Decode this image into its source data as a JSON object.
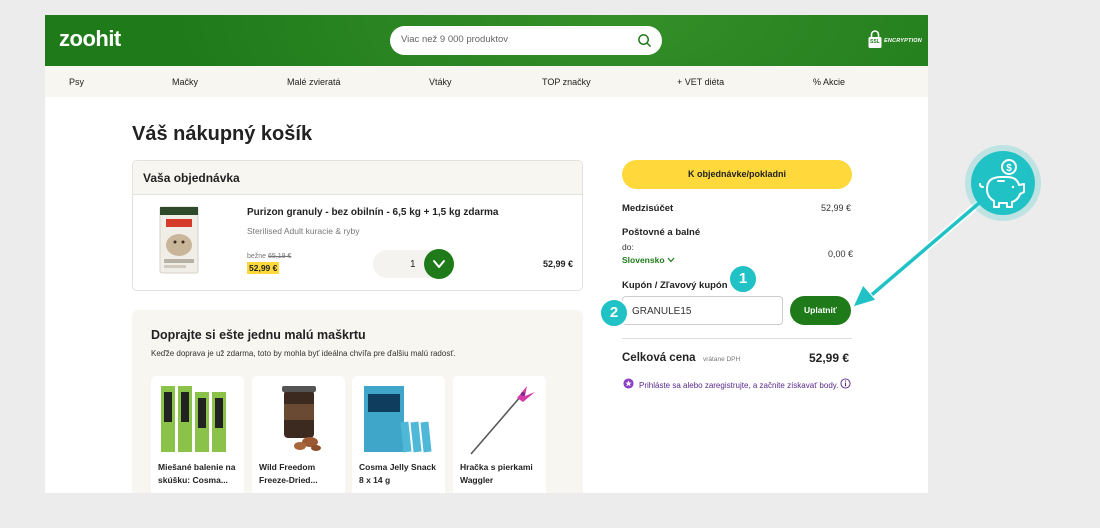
{
  "header": {
    "logo": "zoohit",
    "search_placeholder": "Viac než 9 000 produktov",
    "ssl_badge": "SSL",
    "ssl_text": "ENCRYPTION"
  },
  "nav": [
    "Psy",
    "Mačky",
    "Malé zvieratá",
    "Vtáky",
    "TOP značky",
    "+ VET diéta",
    "% Akcie"
  ],
  "cart": {
    "title": "Váš nákupný košík",
    "order_heading": "Vaša objednávka",
    "item": {
      "name": "Purizon granuly - bez obilnín - 6,5 kg + 1,5 kg zdarma",
      "variant": "Sterilised Adult kuracie & ryby",
      "old_price_label": "bežne",
      "old_price": "65,19 €",
      "price": "52,99 €",
      "quantity": "1",
      "line_total": "52,99 €"
    }
  },
  "recommendations": {
    "title": "Doprajte si ešte jednu malú maškrtu",
    "subtitle": "Keďže doprava je už zdarma, toto by mohla byť ideálna chvíľa pre ďalšiu malú radosť.",
    "items": [
      {
        "name": "Miešané balenie na skúšku: Cosma..."
      },
      {
        "name": "Wild Freedom Freeze-Dried..."
      },
      {
        "name": "Cosma Jelly Snack 8 x 14 g"
      },
      {
        "name": "Hračka s pierkami Waggler"
      }
    ]
  },
  "summary": {
    "checkout_label": "K objednávke/pokladni",
    "subtotal_label": "Medzisúčet",
    "subtotal_value": "52,99 €",
    "shipping_label": "Poštovné a balné",
    "shipping_to": "do:",
    "country": "Slovensko",
    "shipping_value": "0,00 €",
    "coupon_label": "Kupón / Zľavový kupón",
    "coupon_value": "GRANULE15",
    "apply_label": "Uplatniť",
    "total_label": "Celková cena",
    "total_sub": "vrátane DPH",
    "total_value": "52,99 €",
    "promo_text": "Prihláste sa alebo zaregistrujte, a začnite získavať body."
  },
  "annotations": {
    "badge1": "1",
    "badge2": "2",
    "accent": "#21c2c6"
  },
  "colors": {
    "brand_green": "#1f7a1a",
    "checkout_yellow": "#ffd93b"
  }
}
